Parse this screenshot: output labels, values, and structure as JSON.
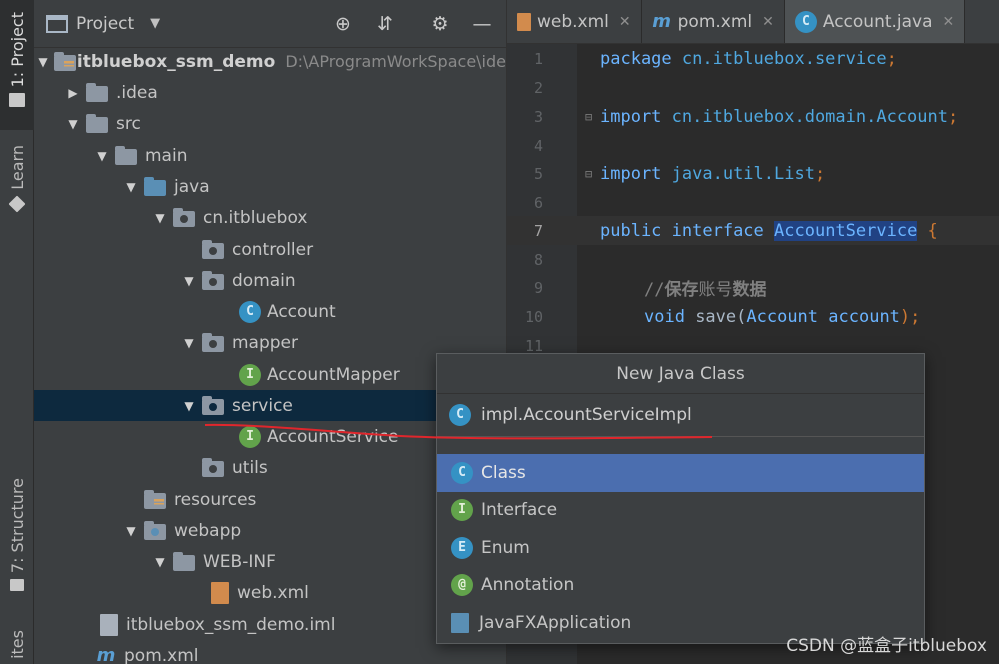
{
  "sidebar": {
    "project_tab": "1: Project",
    "learn_tab": "Learn",
    "structure_tab": "7: Structure",
    "favorites_tab": "ites"
  },
  "project_panel": {
    "title": "Project",
    "tree": [
      {
        "label": "itbluebox_ssm_demo",
        "path": "D:\\AProgramWorkSpace\\ide",
        "icon": "module-folder-icon"
      },
      {
        "label": ".idea",
        "icon": "folder-icon"
      },
      {
        "label": "src",
        "icon": "folder-icon"
      },
      {
        "label": "main",
        "icon": "folder-icon"
      },
      {
        "label": "java",
        "icon": "source-folder-icon"
      },
      {
        "label": "cn.itbluebox",
        "icon": "package-icon"
      },
      {
        "label": "controller",
        "icon": "package-icon"
      },
      {
        "label": "domain",
        "icon": "package-icon"
      },
      {
        "label": "Account",
        "icon": "class-icon",
        "badge": "C"
      },
      {
        "label": "mapper",
        "icon": "package-icon"
      },
      {
        "label": "AccountMapper",
        "icon": "interface-icon",
        "badge": "I"
      },
      {
        "label": "service",
        "icon": "package-icon"
      },
      {
        "label": "AccountService",
        "icon": "interface-icon",
        "badge": "I"
      },
      {
        "label": "utils",
        "icon": "package-icon"
      },
      {
        "label": "resources",
        "icon": "resources-folder-icon"
      },
      {
        "label": "webapp",
        "icon": "web-folder-icon"
      },
      {
        "label": "WEB-INF",
        "icon": "folder-icon"
      },
      {
        "label": "web.xml",
        "icon": "xml-file-icon"
      },
      {
        "label": "itbluebox_ssm_demo.iml",
        "icon": "iml-file-icon"
      },
      {
        "label": "pom.xml",
        "icon": "maven-icon"
      }
    ]
  },
  "editor": {
    "tabs": [
      {
        "label": "web.xml",
        "icon": "xml-file-icon"
      },
      {
        "label": "pom.xml",
        "icon": "maven-icon"
      },
      {
        "label": "Account.java",
        "icon": "class-icon",
        "badge": "C"
      }
    ],
    "line_numbers": [
      "1",
      "2",
      "3",
      "4",
      "5",
      "6",
      "7",
      "8",
      "9",
      "10",
      "11"
    ],
    "code": {
      "l1_kw": "package",
      "l1_rest": " cn.itbluebox.service",
      "l1_end": ";",
      "l3_kw": "import",
      "l3_rest": " cn.itbluebox.domain.Account",
      "l3_end": ";",
      "l5_kw": "import",
      "l5_rest": " java.util.List",
      "l5_end": ";",
      "l7_kw1": "public",
      "l7_kw2": " interface ",
      "l7_name": "AccountService",
      "l7_end": " {",
      "l9_slashes": "//",
      "l9_comment_bold": "保存",
      "l9_comment": "账号",
      "l9_comment_bold2": "数据",
      "l10_kw": "void",
      "l10_fn": " save(",
      "l10_type": "Account",
      "l10_param": " account",
      "l10_end": ");"
    }
  },
  "popup": {
    "title": "New Java Class",
    "input_value": "impl.AccountServiceImpl",
    "kinds": [
      {
        "label": "Class",
        "badge": "C",
        "icon": "class-icon"
      },
      {
        "label": "Interface",
        "badge": "I",
        "icon": "interface-icon"
      },
      {
        "label": "Enum",
        "badge": "E",
        "icon": "enum-icon"
      },
      {
        "label": "Annotation",
        "badge": "@",
        "icon": "annotation-icon"
      },
      {
        "label": "JavaFXApplication",
        "badge": "",
        "icon": "javafx-icon"
      }
    ]
  },
  "colors": {
    "selection": "#0d293e",
    "popup_selection": "#4b6eaf",
    "annotation_line": "#e0262c"
  },
  "watermark": "CSDN @蓝盒子itbluebox"
}
